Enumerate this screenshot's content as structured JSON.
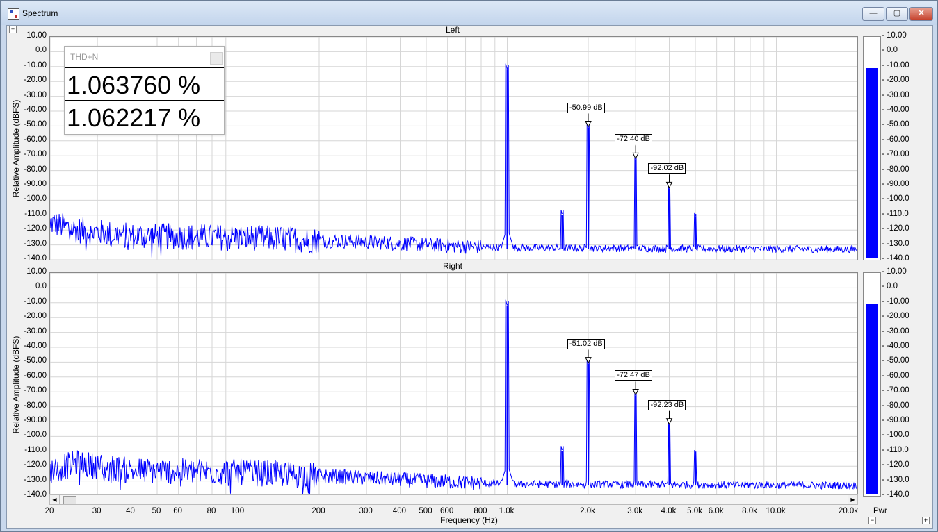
{
  "window": {
    "title": "Spectrum",
    "minimize": "—",
    "maximize": "▢",
    "close": "✕",
    "expand_top": "+",
    "collapse_bottom": "−",
    "expand_bottom": "+"
  },
  "colors": {
    "trace": "#0000ff",
    "grid": "#d6d6d6",
    "plot_bg": "#ffffff"
  },
  "thd_panel": {
    "title": "THD+N",
    "values": [
      "1.063760 %",
      "1.062217 %"
    ]
  },
  "meter": {
    "label": "Pwr",
    "ticks": [
      "10.00",
      "0.0",
      "-10.00",
      "-20.00",
      "-30.00",
      "-40.00",
      "-50.00",
      "-60.00",
      "-70.00",
      "-80.00",
      "-90.00",
      "-100.0",
      "-110.0",
      "-120.0",
      "-130.0",
      "-140.0"
    ],
    "left_level_db": -11,
    "right_level_db": -11
  },
  "panels": [
    {
      "title": "Left",
      "ylabel": "Relative Amplitude (dBFS)",
      "markers": [
        {
          "label": "-50.99 dB",
          "freq": 2000,
          "db": -50.99
        },
        {
          "label": "-72.40 dB",
          "freq": 3000,
          "db": -72.4
        },
        {
          "label": "-92.02 dB",
          "freq": 4000,
          "db": -92.02
        }
      ]
    },
    {
      "title": "Right",
      "ylabel": "Relative Amplitude (dBFS)",
      "markers": [
        {
          "label": "-51.02 dB",
          "freq": 2000,
          "db": -51.02
        },
        {
          "label": "-72.47 dB",
          "freq": 3000,
          "db": -72.47
        },
        {
          "label": "-92.23 dB",
          "freq": 4000,
          "db": -92.23
        }
      ]
    }
  ],
  "chart_data": {
    "type": "line",
    "xlabel": "Frequency (Hz)",
    "ylabel": "Relative Amplitude (dBFS)",
    "x_scale": "log",
    "xlim": [
      20,
      20000
    ],
    "ylim": [
      -140,
      10
    ],
    "grid": true,
    "yticks": [
      "10.00",
      "0.0",
      "-10.00",
      "-20.00",
      "-30.00",
      "-40.00",
      "-50.00",
      "-60.00",
      "-70.00",
      "-80.00",
      "-90.00",
      "-100.0",
      "-110.0",
      "-120.0",
      "-130.0",
      "-140.0"
    ],
    "xticks": [
      {
        "v": 20,
        "l": "20"
      },
      {
        "v": 30,
        "l": "30"
      },
      {
        "v": 40,
        "l": "40"
      },
      {
        "v": 50,
        "l": "50"
      },
      {
        "v": 60,
        "l": "60"
      },
      {
        "v": 80,
        "l": "80"
      },
      {
        "v": 100,
        "l": "100"
      },
      {
        "v": 200,
        "l": "200"
      },
      {
        "v": 300,
        "l": "300"
      },
      {
        "v": 400,
        "l": "400"
      },
      {
        "v": 500,
        "l": "500"
      },
      {
        "v": 600,
        "l": "600"
      },
      {
        "v": 800,
        "l": "800"
      },
      {
        "v": 1000,
        "l": "1.0k"
      },
      {
        "v": 2000,
        "l": "2.0k"
      },
      {
        "v": 3000,
        "l": "3.0k"
      },
      {
        "v": 4000,
        "l": "4.0k"
      },
      {
        "v": 5000,
        "l": "5.0k"
      },
      {
        "v": 6000,
        "l": "6.0k"
      },
      {
        "v": 8000,
        "l": "8.0k"
      },
      {
        "v": 10000,
        "l": "10.0k"
      },
      {
        "v": 20000,
        "l": "20.0k"
      }
    ],
    "series": [
      {
        "channel": "Left",
        "peaks": [
          [
            1000,
            -12
          ],
          [
            1600,
            -110
          ],
          [
            2000,
            -50.99
          ],
          [
            3000,
            -72.4
          ],
          [
            4000,
            -92.02
          ],
          [
            5000,
            -111
          ]
        ],
        "noise_floor": [
          [
            20,
            -115
          ],
          [
            25,
            -120
          ],
          [
            40,
            -124
          ],
          [
            100,
            -125
          ],
          [
            300,
            -128
          ],
          [
            700,
            -131
          ],
          [
            1000,
            -132
          ],
          [
            20000,
            -133
          ]
        ]
      },
      {
        "channel": "Right",
        "peaks": [
          [
            1000,
            -12
          ],
          [
            1600,
            -110
          ],
          [
            2000,
            -51.02
          ],
          [
            3000,
            -72.47
          ],
          [
            4000,
            -92.23
          ],
          [
            5000,
            -112
          ]
        ],
        "noise_floor": [
          [
            20,
            -123
          ],
          [
            25,
            -118
          ],
          [
            40,
            -123
          ],
          [
            100,
            -124
          ],
          [
            300,
            -128
          ],
          [
            700,
            -131
          ],
          [
            1000,
            -132
          ],
          [
            20000,
            -133
          ]
        ]
      }
    ]
  }
}
